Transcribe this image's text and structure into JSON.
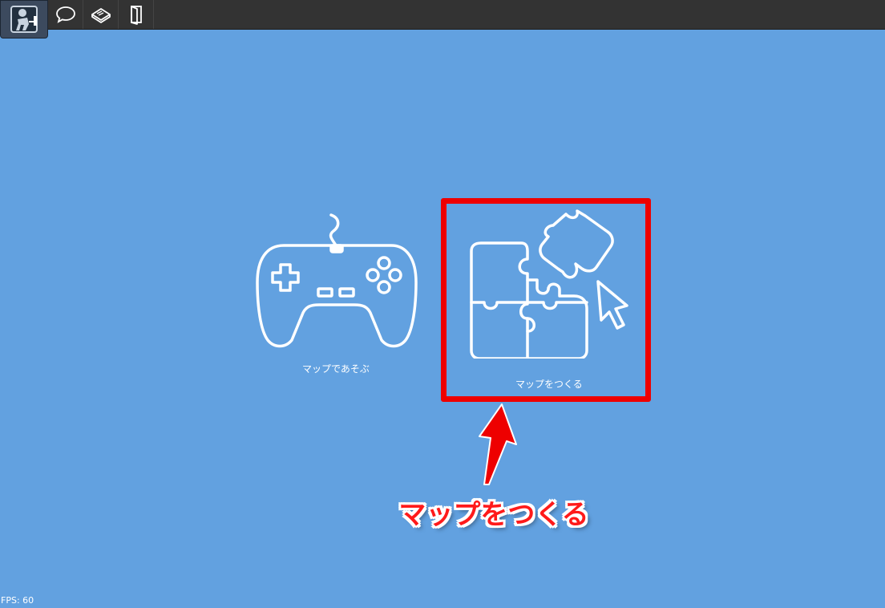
{
  "toolbar": {
    "buttons": [
      {
        "icon": "avatar-icon"
      },
      {
        "icon": "chat-bubble-icon"
      },
      {
        "icon": "book-icon"
      },
      {
        "icon": "exit-door-icon"
      }
    ]
  },
  "menu": {
    "play": {
      "label": "マップであそぶ",
      "icon": "gamepad-icon"
    },
    "create": {
      "label": "マップをつくる",
      "icon": "puzzle-cursor-icon"
    }
  },
  "annotation": {
    "label": "マップをつくる",
    "color": "#ee0000"
  },
  "status": {
    "fps_text": "FPS: 60"
  },
  "colors": {
    "background": "#62a1e0",
    "toolbar": "#333333",
    "highlight": "#ee0000"
  }
}
